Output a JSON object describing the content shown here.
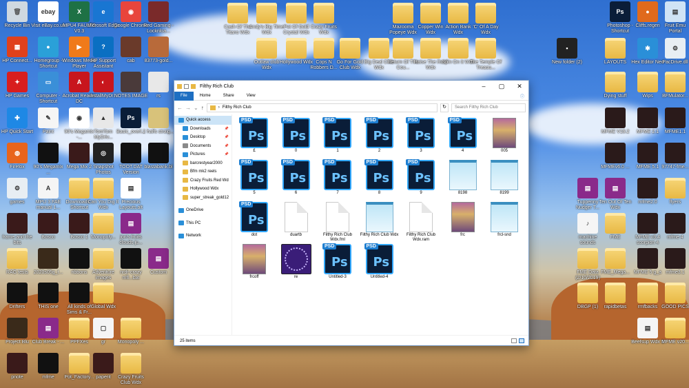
{
  "desktop": {
    "icons": [
      {
        "label": "Recycle Bin",
        "kind": "bin",
        "color": "#cfd8e0"
      },
      {
        "label": "Visit eBay.co.uk",
        "kind": "app",
        "color": "#ffffff",
        "glyph": "ebay"
      },
      {
        "label": "MPU4 FAULTS V0.3",
        "kind": "app",
        "color": "#1e7145",
        "glyph": "X"
      },
      {
        "label": "Microsoft Edge",
        "kind": "app",
        "color": "#1976d2",
        "glyph": "e"
      },
      {
        "label": "Google Chrome",
        "kind": "app",
        "color": "#e8453c",
        "glyph": "◉"
      },
      {
        "label": "Red Gaming - Locknloa...",
        "kind": "img",
        "color": "#7a2a2a"
      },
      {
        "label": "Cash Of The Titans Wdx",
        "kind": "folder"
      },
      {
        "label": "Andy's Big Time Wdx",
        "kind": "folder"
      },
      {
        "label": "Pot Of Gold Crystal Wdx",
        "kind": "folder"
      },
      {
        "label": "Crazy Fruits Wdx",
        "kind": "folder"
      },
      {
        "label": "Mazooma Popeye Wdx",
        "kind": "folder"
      },
      {
        "label": "Copper Win Wdx",
        "kind": "folder"
      },
      {
        "label": "Action Bank Wdx",
        "kind": "folder"
      },
      {
        "label": "'C' Of A Day Wdx",
        "kind": "folder"
      },
      {
        "label": "Photoshop - Shortcut",
        "kind": "app",
        "color": "#0a1d38",
        "glyph": "Ps"
      },
      {
        "label": "Cliffs.regen",
        "kind": "app",
        "color": "#e06a1c",
        "glyph": "●"
      },
      {
        "label": "Fruit Emu Portal",
        "kind": "app",
        "color": "#cfe3f5",
        "glyph": "▤"
      },
      {
        "label": "HP Connect...",
        "kind": "app",
        "color": "#e0411c",
        "glyph": "▦"
      },
      {
        "label": "Homegroup - Shortcut",
        "kind": "app",
        "color": "#2aa0d8",
        "glyph": "●"
      },
      {
        "label": "Windows Media Player",
        "kind": "app",
        "color": "#f07a1a",
        "glyph": "▶"
      },
      {
        "label": "HP Support Assistant",
        "kind": "app",
        "color": "#0a6fc2",
        "glyph": "?"
      },
      {
        "label": "cab",
        "kind": "img",
        "color": "#6a3a2a"
      },
      {
        "label": "83773-gold...",
        "kind": "img",
        "color": "#b86a3a"
      },
      {
        "label": "Outlaw club Wdx",
        "kind": "folder"
      },
      {
        "label": "Hollywood Wdx",
        "kind": "folder"
      },
      {
        "label": "Cops N Robbers D...",
        "kind": "folder"
      },
      {
        "label": "Go For Gold Club Wdx",
        "kind": "folder"
      },
      {
        "label": "Big Deal Club Wdx",
        "kind": "folder"
      },
      {
        "label": "Return Of The Cou...",
        "kind": "folder"
      },
      {
        "label": "Raise The Roof Wdx",
        "kind": "folder"
      },
      {
        "label": "Spin On It Wdx",
        "kind": "folder"
      },
      {
        "label": "The Temple Of Treasu...",
        "kind": "folder"
      },
      {
        "label": "New folder (2)",
        "kind": "app",
        "color": "#222",
        "glyph": "▪"
      },
      {
        "label": "LAYOUTS",
        "kind": "folder"
      },
      {
        "label": "Hex Editor Neo",
        "kind": "app",
        "color": "#2a8fd8",
        "glyph": "✱"
      },
      {
        "label": "PacDrive.dll",
        "kind": "app",
        "color": "#e8eef3",
        "glyph": "⚙"
      },
      {
        "label": "HP Games",
        "kind": "app",
        "color": "#d81e1e",
        "glyph": "✦"
      },
      {
        "label": "Computer - Shortcut",
        "kind": "app",
        "color": "#3a8fd8",
        "glyph": "▭"
      },
      {
        "label": "Acrobat Reader DC",
        "kind": "app",
        "color": "#c8161d",
        "glyph": "A"
      },
      {
        "label": "installMyDr...",
        "kind": "app",
        "color": "#c8161d",
        "glyph": "◐"
      },
      {
        "label": "NOTES IMAGE",
        "kind": "img",
        "color": "#4a3a3a"
      },
      {
        "label": "rs",
        "kind": "img",
        "color": "#e8e8e8"
      },
      {
        "label": "Dying stuff",
        "kind": "folder"
      },
      {
        "label": "Wips",
        "kind": "folder"
      },
      {
        "label": "BFMulator...",
        "kind": "folder"
      },
      {
        "label": "HP Quick Start",
        "kind": "app",
        "color": "#1e88e5",
        "glyph": "✚"
      },
      {
        "label": "Paint",
        "kind": "app",
        "color": "#f5f5f5",
        "glyph": "✎"
      },
      {
        "label": "90's Megamix -...",
        "kind": "app",
        "color": "#ffffff",
        "glyph": "◉"
      },
      {
        "label": "TomTom MyDriv...",
        "kind": "app",
        "color": "#e8e8e8",
        "glyph": "▲"
      },
      {
        "label": "Basic_overl...",
        "kind": "app",
        "color": "#0a1d38",
        "glyph": "Ps"
      },
      {
        "label": "2 halfs straig...",
        "kind": "img",
        "color": "#d8c27a"
      },
      {
        "label": "MFME V19.2",
        "kind": "img",
        "color": "#2a1a1a"
      },
      {
        "label": "MFME 2.1",
        "kind": "img",
        "color": "#2a1a1a"
      },
      {
        "label": "MFME1.1",
        "kind": "img",
        "color": "#2a1a1a"
      },
      {
        "label": "Firefox",
        "kind": "app",
        "color": "#e8641c",
        "glyph": "◍"
      },
      {
        "label": "90's Megamix ...",
        "kind": "img",
        "color": "#111"
      },
      {
        "label": "Mega Mix 2",
        "kind": "img",
        "color": "#3a1a1a"
      },
      {
        "label": "Snapshot Photos",
        "kind": "app",
        "color": "#222",
        "glyph": "◎"
      },
      {
        "label": "TOOT.DAT Version",
        "kind": "img",
        "color": "#111"
      },
      {
        "label": "blastabank.bl",
        "kind": "img",
        "color": "#111"
      },
      {
        "label": "MFMEv6.0 ...",
        "kind": "img",
        "color": "#2a1a1a"
      },
      {
        "label": "MFME 5.1",
        "kind": "img",
        "color": "#2a1a1a"
      },
      {
        "label": "97747-fme...",
        "kind": "img",
        "color": "#2a1a1a"
      },
      {
        "label": "games",
        "kind": "app",
        "color": "#e8eef3",
        "glyph": "⚙"
      },
      {
        "label": "MPU 3 FAE manual 1...",
        "kind": "app",
        "color": "#f5f5f5",
        "glyph": "A"
      },
      {
        "label": "Downloads - Shortcut",
        "kind": "folder"
      },
      {
        "label": "Can You Dig It Wdx",
        "kind": "folder"
      },
      {
        "label": "Precious Layouts.alt",
        "kind": "app",
        "color": "#ffffff",
        "glyph": "▤"
      },
      {
        "label": "Tuppenny Nudger T...",
        "kind": "app",
        "color": "#8a2a8a",
        "glyph": "▤"
      },
      {
        "label": "Ten Out Of Ten Wdx",
        "kind": "app",
        "color": "#8a2a8a",
        "glyph": "▤"
      },
      {
        "label": "mfme2.0",
        "kind": "img",
        "color": "#2a1a1a"
      },
      {
        "label": "flyers",
        "kind": "folder"
      },
      {
        "label": "frame and the bits",
        "kind": "img",
        "color": "#3a1a1a"
      },
      {
        "label": "Bosco",
        "kind": "img",
        "color": "#3a1a1a"
      },
      {
        "label": "Bosco 1",
        "kind": "img",
        "color": "#3a1a1a"
      },
      {
        "label": "Monopoly...",
        "kind": "folder"
      },
      {
        "label": "jon's fruits clouds ju...",
        "kind": "app",
        "color": "#8a2a8a",
        "glyph": "▤"
      },
      {
        "label": "machine sounds",
        "kind": "app",
        "color": "#f5f5f5",
        "glyph": "♪"
      },
      {
        "label": "FME",
        "kind": "folder"
      },
      {
        "label": "MFME v3.4 scorpion 4",
        "kind": "img",
        "color": "#2a1a1a"
      },
      {
        "label": "mfme 4",
        "kind": "img",
        "color": "#2a1a1a"
      },
      {
        "label": "RAG tests",
        "kind": "folder"
      },
      {
        "label": "2020s05g_t...",
        "kind": "img",
        "color": "#3a2a1a"
      },
      {
        "label": "ribbons",
        "kind": "img",
        "color": "#111"
      },
      {
        "label": "Adventure images",
        "kind": "folder"
      },
      {
        "label": "nrdr-crazy mfl...bat",
        "kind": "img",
        "color": "#111"
      },
      {
        "label": "Custom",
        "kind": "app",
        "color": "#8a2a8a",
        "glyph": "▤"
      },
      {
        "label": "FME Data (2/10/2019)",
        "kind": "folder"
      },
      {
        "label": "FME_Mega...",
        "kind": "folder"
      },
      {
        "label": "MFME 5 g_a",
        "kind": "img",
        "color": "#2a1a1a"
      },
      {
        "label": "mfme3.1",
        "kind": "img",
        "color": "#2a1a1a"
      },
      {
        "label": "Drifters",
        "kind": "img",
        "color": "#111"
      },
      {
        "label": "THIS one",
        "kind": "img",
        "color": "#111"
      },
      {
        "label": "All kinds of Sims & Fr...",
        "kind": "img",
        "color": "#111"
      },
      {
        "label": "Global Wdx",
        "kind": "folder"
      },
      {
        "label": "DBGP (1)",
        "kind": "folder"
      },
      {
        "label": "rapidbetas",
        "kind": "folder"
      },
      {
        "label": "rmfbacks",
        "kind": "folder"
      },
      {
        "label": "GOOD PICS",
        "kind": "folder"
      },
      {
        "label": "Project Blu",
        "kind": "img",
        "color": "#3a2a1a"
      },
      {
        "label": "Club Break - ...",
        "kind": "app",
        "color": "#8a2a8a",
        "glyph": "▤"
      },
      {
        "label": "PPFXes",
        "kind": "folder"
      },
      {
        "label": "gr",
        "kind": "app",
        "color": "#f5f5f5",
        "glyph": "▢"
      },
      {
        "label": "Monopoly ...",
        "kind": "folder"
      },
      {
        "label": "Beefsup Wdx 3",
        "kind": "app",
        "color": "#f5f5f5",
        "glyph": "▤"
      },
      {
        "label": "MFME v20...",
        "kind": "folder"
      },
      {
        "label": "pnote",
        "kind": "img",
        "color": "#3a1a1a"
      },
      {
        "label": "mfme",
        "kind": "img",
        "color": "#111"
      },
      {
        "label": "Pot_Factory...",
        "kind": "folder"
      },
      {
        "label": "paperit",
        "kind": "img",
        "color": "#3a1a1a"
      },
      {
        "label": "Crazy Fruits Club Wdx",
        "kind": "folder"
      }
    ]
  },
  "explorer": {
    "title": "Filthy Rich Club",
    "ribbon_tabs": [
      "File",
      "Home",
      "Share",
      "View"
    ],
    "address_path": "Filthy Rich Club",
    "search_placeholder": "Search Filthy Rich Club",
    "status_text": "25 items",
    "nav": [
      {
        "label": "Quick access",
        "selected": true,
        "level": 0,
        "icon": "star",
        "color": "#2a8fd8"
      },
      {
        "label": "Downloads",
        "level": 1,
        "pin": true,
        "icon": "download",
        "color": "#2a8fd8"
      },
      {
        "label": "Desktop",
        "level": 1,
        "pin": true,
        "icon": "desktop",
        "color": "#2a8fd8"
      },
      {
        "label": "Documents",
        "level": 1,
        "pin": true,
        "icon": "doc",
        "color": "#8a8a8a"
      },
      {
        "label": "Pictures",
        "level": 1,
        "pin": true,
        "icon": "picture",
        "color": "#2a8fd8"
      },
      {
        "label": "barcrestyear2000",
        "level": 1,
        "icon": "folder",
        "color": "#e8b844"
      },
      {
        "label": "Bfm mk2 reels",
        "level": 1,
        "icon": "folder",
        "color": "#e8b844"
      },
      {
        "label": "Crazy Fruits Red Wd",
        "level": 1,
        "icon": "folder",
        "color": "#e8b844"
      },
      {
        "label": "Hollywood Wdx",
        "level": 1,
        "icon": "folder",
        "color": "#e8b844"
      },
      {
        "label": "super_streak_gold12",
        "level": 1,
        "icon": "folder",
        "color": "#e8b844"
      },
      {
        "label": "OneDrive",
        "level": 0,
        "gap": true,
        "icon": "cloud",
        "color": "#2a8fd8"
      },
      {
        "label": "This PC",
        "level": 0,
        "gap": true,
        "icon": "pc",
        "color": "#2a8fd8"
      },
      {
        "label": "Network",
        "level": 0,
        "gap": true,
        "icon": "network",
        "color": "#2a8fd8"
      }
    ],
    "files": [
      {
        "name": "£",
        "type": "psd"
      },
      {
        "name": "0",
        "type": "psd"
      },
      {
        "name": "1",
        "type": "psd"
      },
      {
        "name": "2",
        "type": "psd"
      },
      {
        "name": "3",
        "type": "psd"
      },
      {
        "name": "4",
        "type": "psd"
      },
      {
        "name": "005",
        "type": "image"
      },
      {
        "name": "5",
        "type": "psd"
      },
      {
        "name": "6",
        "type": "psd"
      },
      {
        "name": "7",
        "type": "psd"
      },
      {
        "name": "8",
        "type": "psd"
      },
      {
        "name": "9",
        "type": "psd"
      },
      {
        "name": "8198",
        "type": "notepad"
      },
      {
        "name": "8199",
        "type": "notepad"
      },
      {
        "name": "dot",
        "type": "psd"
      },
      {
        "name": "duartb",
        "type": "doc"
      },
      {
        "name": "Filthy Rich Club Wdx.fml",
        "type": "doc"
      },
      {
        "name": "Filthy Rich Club Wdx",
        "type": "notepad"
      },
      {
        "name": "Filthy Rich Club Wdx.ram",
        "type": "doc"
      },
      {
        "name": "frc",
        "type": "image"
      },
      {
        "name": "frcl-snd",
        "type": "notepad"
      },
      {
        "name": "frcoff",
        "type": "image"
      },
      {
        "name": "re",
        "type": "purple"
      },
      {
        "name": "Untitled-3",
        "type": "psd"
      },
      {
        "name": "Untitled-4",
        "type": "psd"
      }
    ],
    "psd_tag": "PSD",
    "psd_glyph": "Ps"
  }
}
